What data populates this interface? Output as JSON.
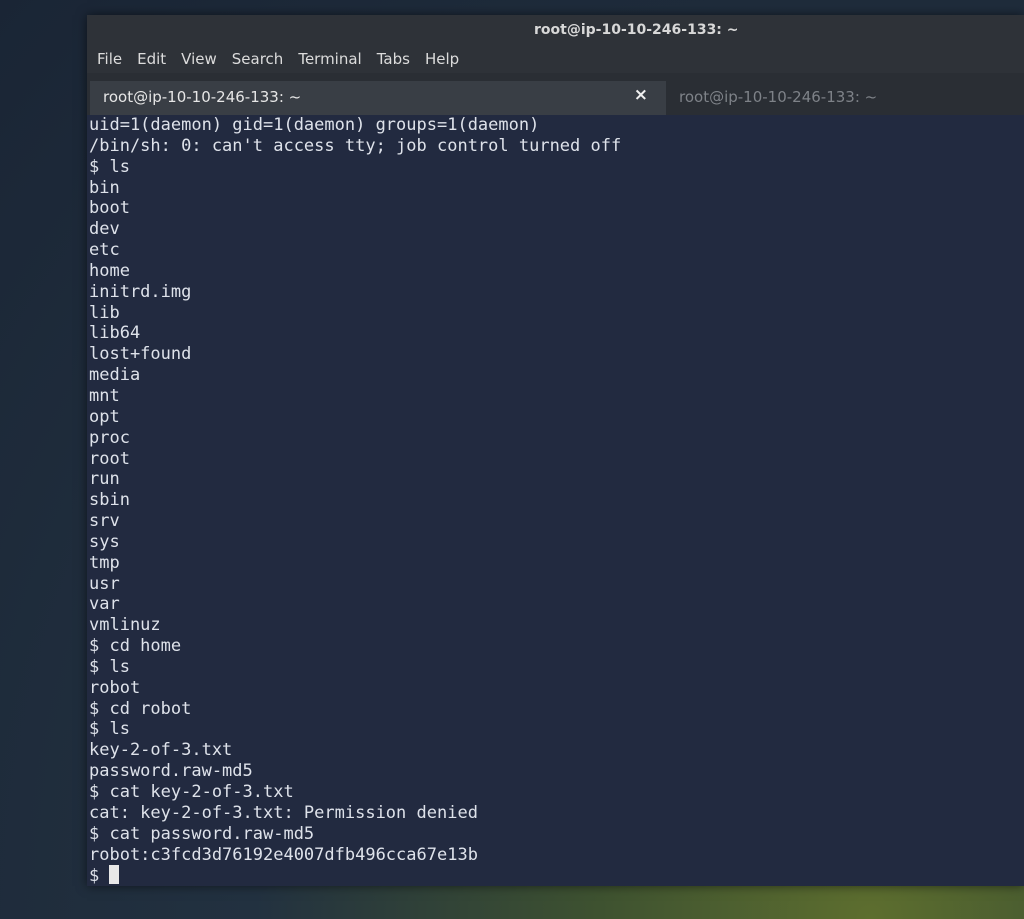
{
  "window": {
    "title": "root@ip-10-10-246-133: ~"
  },
  "menu": [
    "File",
    "Edit",
    "View",
    "Search",
    "Terminal",
    "Tabs",
    "Help"
  ],
  "tabs": [
    {
      "label": "root@ip-10-10-246-133: ~",
      "active": true,
      "close": "×"
    },
    {
      "label": "root@ip-10-10-246-133: ~",
      "active": false
    }
  ],
  "terminal": {
    "lines": [
      "uid=1(daemon) gid=1(daemon) groups=1(daemon)",
      "/bin/sh: 0: can't access tty; job control turned off",
      "$ ls",
      "bin",
      "boot",
      "dev",
      "etc",
      "home",
      "initrd.img",
      "lib",
      "lib64",
      "lost+found",
      "media",
      "mnt",
      "opt",
      "proc",
      "root",
      "run",
      "sbin",
      "srv",
      "sys",
      "tmp",
      "usr",
      "var",
      "vmlinuz",
      "$ cd home",
      "$ ls",
      "robot",
      "$ cd robot",
      "$ ls",
      "key-2-of-3.txt",
      "password.raw-md5",
      "$ cat key-2-of-3.txt",
      "cat: key-2-of-3.txt: Permission denied",
      "$ cat password.raw-md5",
      "robot:c3fcd3d76192e4007dfb496cca67e13b"
    ],
    "prompt": "$ "
  },
  "colors": {
    "terminal_bg": "#222a40",
    "terminal_fg": "#dee2ea",
    "chrome_bg": "#2e3238"
  }
}
